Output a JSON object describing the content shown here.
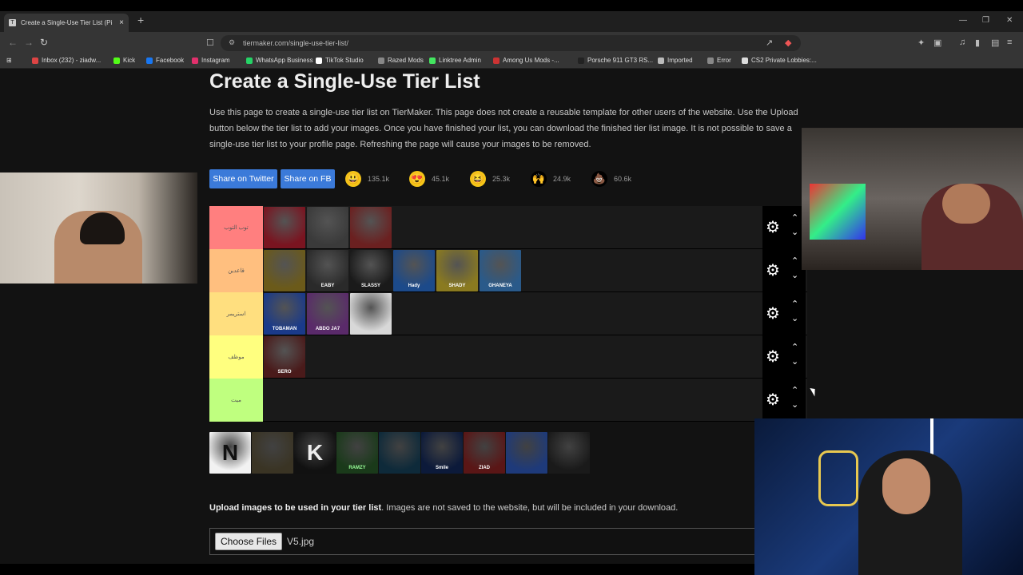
{
  "browser": {
    "tab_title": "Create a Single-Use Tier List (Pi",
    "tab_close": "×",
    "new_tab": "+",
    "url": "tiermaker.com/single-use-tier-list/",
    "bookmarks": [
      {
        "label": "Inbox (232) - ziadw...",
        "color": "#d44"
      },
      {
        "label": "Kick",
        "color": "#53fc18"
      },
      {
        "label": "Facebook",
        "color": "#1877f2"
      },
      {
        "label": "Instagram",
        "color": "#e1306c"
      },
      {
        "label": "WhatsApp Business",
        "color": "#25d366"
      },
      {
        "label": "TikTok Studio",
        "color": "#fff"
      },
      {
        "label": "Razed Mods",
        "color": "#888"
      },
      {
        "label": "Linktree Admin",
        "color": "#43e660"
      },
      {
        "label": "Among Us Mods -...",
        "color": "#c33"
      },
      {
        "label": "Porsche 911 GT3 RS...",
        "color": "#222"
      },
      {
        "label": "Imported",
        "color": "#bbb"
      },
      {
        "label": "Error",
        "color": "#888"
      },
      {
        "label": "CS2 Private Lobbies:...",
        "color": "#ddd"
      }
    ]
  },
  "page": {
    "title": "Create a Single-Use Tier List",
    "description": "Use this page to create a single-use tier list on TierMaker. This page does not create a reusable template for other users of the website. Use the Upload button below the tier list to add your images. Once you have finished your list, you can download the finished tier list image. It is not possible to save a single-use tier list to your profile page. Refreshing the page will cause your images to be removed.",
    "share_twitter": "Share on Twitter",
    "share_fb": "Share on FB",
    "reactions": [
      {
        "emoji": "😃",
        "count": "135.1k",
        "bg": "#f5c518"
      },
      {
        "emoji": "😍",
        "count": "45.1k",
        "bg": "#f5c518"
      },
      {
        "emoji": "😆",
        "count": "25.3k",
        "bg": "#f5c518"
      },
      {
        "emoji": "🙌",
        "count": "24.9k",
        "bg": "#000"
      },
      {
        "emoji": "💩",
        "count": "60.6k",
        "bg": "#000"
      }
    ]
  },
  "tiers": [
    {
      "label": "توب التوب",
      "color": "#ff7f7f",
      "items": [
        {
          "color": "#7a1420",
          "tag": ""
        },
        {
          "color": "#3a3a3a",
          "tag": ""
        },
        {
          "color": "#6b2020",
          "tag": ""
        }
      ]
    },
    {
      "label": "قاعدين",
      "color": "#ffbf7f",
      "items": [
        {
          "color": "#6b5a1a",
          "tag": ""
        },
        {
          "color": "#2a2a2a",
          "tag": "EABY"
        },
        {
          "color": "#1a1a1a",
          "tag": "SLASSY"
        },
        {
          "color": "#1c4a8a",
          "tag": "Hady"
        },
        {
          "color": "#8a7a20",
          "tag": "SHADY"
        },
        {
          "color": "#2a5a8a",
          "tag": "GHANEYA"
        }
      ]
    },
    {
      "label": "استريمر",
      "color": "#ffdf7f",
      "items": [
        {
          "color": "#1a3a8a",
          "tag": "TOBAMAN"
        },
        {
          "color": "#5a2a6a",
          "tag": "ABDO JA7"
        },
        {
          "color": "#d8d8d8",
          "tag": ""
        }
      ]
    },
    {
      "label": "موظف",
      "color": "#ffff7f",
      "items": [
        {
          "color": "#4a1a1a",
          "tag": "SERO"
        }
      ]
    },
    {
      "label": "ميت",
      "color": "#bfff7f",
      "items": []
    }
  ],
  "pool_items": [
    {
      "color": "#f2f2f2",
      "tag": "N",
      "fg": "#111"
    },
    {
      "color": "#3a3424",
      "tag": "",
      "fg": "#fff"
    },
    {
      "color": "#111111",
      "tag": "K",
      "fg": "#eee"
    },
    {
      "color": "#1a3a1a",
      "tag": "RAMZY",
      "fg": "#9f9"
    },
    {
      "color": "#0e2a3a",
      "tag": "",
      "fg": "#fff"
    },
    {
      "color": "#0c1a3a",
      "tag": "Smile",
      "fg": "#fff"
    },
    {
      "color": "#5a1616",
      "tag": "ZIAD",
      "fg": "#fff"
    },
    {
      "color": "#1e3a7a",
      "tag": "",
      "fg": "#fff"
    },
    {
      "color": "#1a1a1a",
      "tag": "",
      "fg": "#fff"
    }
  ],
  "upload": {
    "bold": "Upload images to be used in your tier list",
    "rest": ". Images are not saved to the website, but will be included in your download.",
    "button": "Choose Files",
    "file_name": "V5.jpg"
  }
}
